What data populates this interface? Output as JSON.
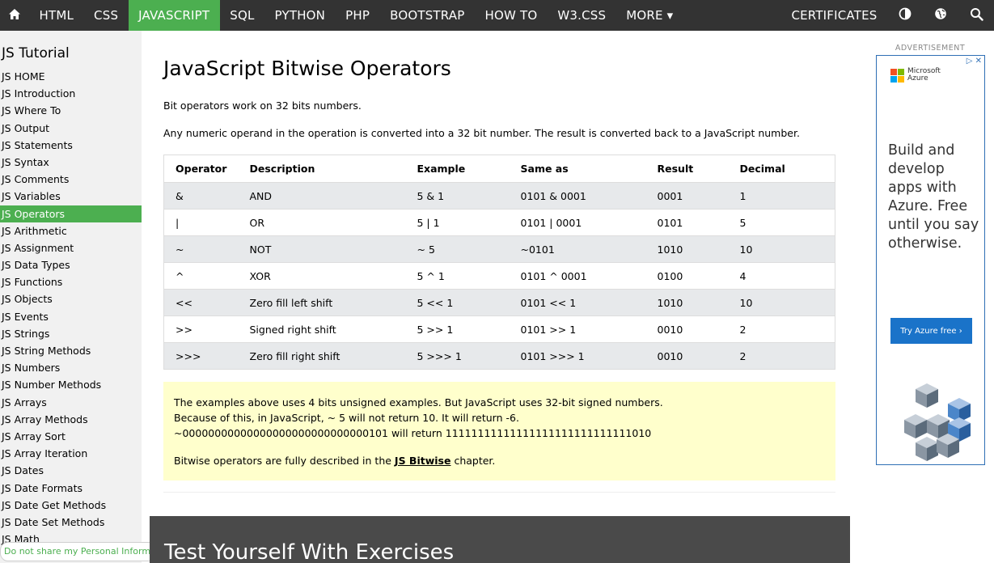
{
  "nav": {
    "items": [
      "HTML",
      "CSS",
      "JAVASCRIPT",
      "SQL",
      "PYTHON",
      "PHP",
      "BOOTSTRAP",
      "HOW TO",
      "W3.CSS",
      "MORE ▾"
    ],
    "active_index": 2,
    "certificates": "CERTIFICATES",
    "icons": [
      "home-icon",
      "contrast-icon",
      "globe-icon",
      "search-icon"
    ]
  },
  "sidebar": {
    "title": "JS Tutorial",
    "items": [
      "JS HOME",
      "JS Introduction",
      "JS Where To",
      "JS Output",
      "JS Statements",
      "JS Syntax",
      "JS Comments",
      "JS Variables",
      "JS Operators",
      "JS Arithmetic",
      "JS Assignment",
      "JS Data Types",
      "JS Functions",
      "JS Objects",
      "JS Events",
      "JS Strings",
      "JS String Methods",
      "JS Numbers",
      "JS Number Methods",
      "JS Arrays",
      "JS Array Methods",
      "JS Array Sort",
      "JS Array Iteration",
      "JS Dates",
      "JS Date Formats",
      "JS Date Get Methods",
      "JS Date Set Methods",
      "JS Math"
    ],
    "active_index": 8,
    "privacy_link": "Do not share my Personal Information"
  },
  "main": {
    "title": "JavaScript Bitwise Operators",
    "intro1": "Bit operators work on 32 bits numbers.",
    "intro2": "Any numeric operand in the operation is converted into a 32 bit number. The result is converted back to a JavaScript number.",
    "table": {
      "headers": [
        "Operator",
        "Description",
        "Example",
        "Same as",
        "Result",
        "Decimal"
      ],
      "rows": [
        [
          "&",
          "AND",
          "5 & 1",
          "0101 & 0001",
          "0001",
          "1"
        ],
        [
          "|",
          "OR",
          "5 | 1",
          "0101 | 0001",
          "0101",
          "5"
        ],
        [
          "~",
          "NOT",
          "~ 5",
          "~0101",
          "1010",
          "10"
        ],
        [
          "^",
          "XOR",
          "5 ^ 1",
          "0101 ^ 0001",
          "0100",
          "4"
        ],
        [
          "<<",
          "Zero fill left shift",
          "5 << 1",
          "0101 << 1",
          "1010",
          "10"
        ],
        [
          ">>",
          "Signed right shift",
          "5 >> 1",
          "0101 >> 1",
          "0010",
          "2"
        ],
        [
          ">>>",
          "Zero fill right shift",
          "5 >>> 1",
          "0101 >>> 1",
          "0010",
          "2"
        ]
      ]
    },
    "note": {
      "line1": "The examples above uses 4 bits unsigned examples. But JavaScript uses 32-bit signed numbers.",
      "line2": "Because of this, in JavaScript, ~ 5 will not return 10. It will return -6.",
      "line3": "~00000000000000000000000000000101 will return 11111111111111111111111111111010",
      "line4_prefix": "Bitwise operators are fully described in the ",
      "line4_link": "JS Bitwise",
      "line4_suffix": " chapter."
    },
    "exercise_title": "Test Yourself With Exercises"
  },
  "ad": {
    "label": "ADVERTISEMENT",
    "brand": "Microsoft Azure",
    "headline": "Build and develop apps with Azure. Free until you say otherwise.",
    "cta": "Try Azure free  ›",
    "choices": "▷ ✕",
    "logo_colors": [
      "#f25022",
      "#7fba00",
      "#00a4ef",
      "#ffb900"
    ],
    "cta_color": "#1a73c9"
  },
  "colors": {
    "nav_bg": "#333333",
    "accent": "#4CAF50",
    "sidebar_bg": "#f1f1f1",
    "table_stripe": "#e7e9eb",
    "note_bg": "#ffffcc",
    "exercise_bg": "#4a4a4a"
  }
}
